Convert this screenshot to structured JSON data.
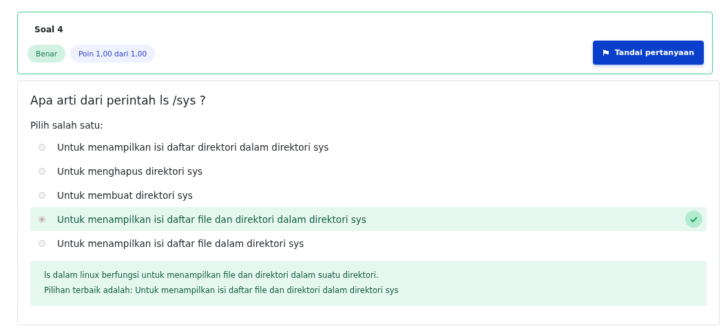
{
  "header": {
    "title": "Soal 4",
    "status": "Benar",
    "points": "Poin 1,00 dari 1,00",
    "flag_button": "Tandai pertanyaan"
  },
  "question": {
    "text": "Apa arti dari perintah ls /sys ?",
    "prompt": "Pilih salah satu:",
    "options": [
      {
        "text": "Untuk menampilkan isi daftar direktori dalam direktori sys",
        "selected": false,
        "correct": false
      },
      {
        "text": "Untuk menghapus direktori sys",
        "selected": false,
        "correct": false
      },
      {
        "text": "Untuk membuat direktori sys",
        "selected": false,
        "correct": false
      },
      {
        "text": "Untuk menampilkan isi daftar file dan direktori dalam direktori sys",
        "selected": true,
        "correct": true
      },
      {
        "text": "Untuk menampilkan isi daftar file dalam direktori sys",
        "selected": false,
        "correct": false
      }
    ]
  },
  "feedback": [
    "ls dalam linux berfungsi untuk menampilkan file dan direktori dalam suatu direktori.",
    "Pilihan terbaik adalah: Untuk menampilkan isi daftar file dan direktori dalam direktori sys"
  ]
}
